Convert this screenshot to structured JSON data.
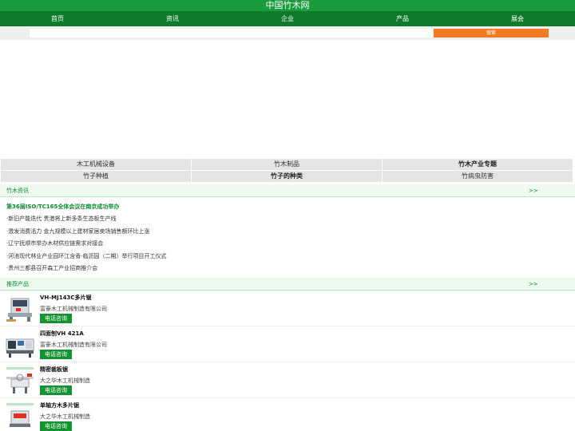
{
  "site": {
    "title": "中国竹木网"
  },
  "nav": [
    "首页",
    "资讯",
    "企业",
    "产品",
    "展会"
  ],
  "search": {
    "button_label": "搜索",
    "placeholder": ""
  },
  "categories": [
    {
      "label": "木工机械设备",
      "bold": false
    },
    {
      "label": "竹木制品",
      "bold": false
    },
    {
      "label": "竹木产业专题",
      "bold": true
    },
    {
      "label": "竹子种植",
      "bold": false
    },
    {
      "label": "竹子的种类",
      "bold": true
    },
    {
      "label": "竹病虫防害",
      "bold": false
    }
  ],
  "news": {
    "title": "竹木资讯",
    "more": ">>",
    "featured": "第36届ISO/TC165全体会议在南京成功举办",
    "items": [
      "·新旧产能迭代 贵港将上新多条生态板生产线",
      "·激发消费活力 金九规模以上建材家居卖场销售额环比上涨",
      "·辽宁抚顺市举办木材供应链需求对接会",
      "·河池现代林业产业园环江含香·临沥园（二期）举行项目开工仪式",
      "·贵州三都县召开森工产业招商推介会"
    ]
  },
  "products": {
    "title": "推荐产品",
    "more": ">>",
    "items": [
      {
        "name": "VH-MJ143C多片锯",
        "company": "富豪木工机械制造有限公司",
        "button": "电话咨询",
        "thumb": "multi-blade-saw-image"
      },
      {
        "name": "四面刨VH 421A",
        "company": "富豪木工机械制造有限公司",
        "button": "电话咨询",
        "thumb": "four-side-planer-image"
      },
      {
        "name": "精密裁板锯",
        "company": "大之华木工机械制造",
        "button": "电话咨询",
        "thumb": "panel-saw-image"
      },
      {
        "name": "单轴方木多片锯",
        "company": "大之华木工机械制造",
        "button": "电话咨询",
        "thumb": "single-shaft-saw-image"
      }
    ]
  },
  "colors": {
    "brand_green": "#1a9c3e",
    "nav_green": "#0d7b2a",
    "accent_orange": "#f47a20"
  }
}
